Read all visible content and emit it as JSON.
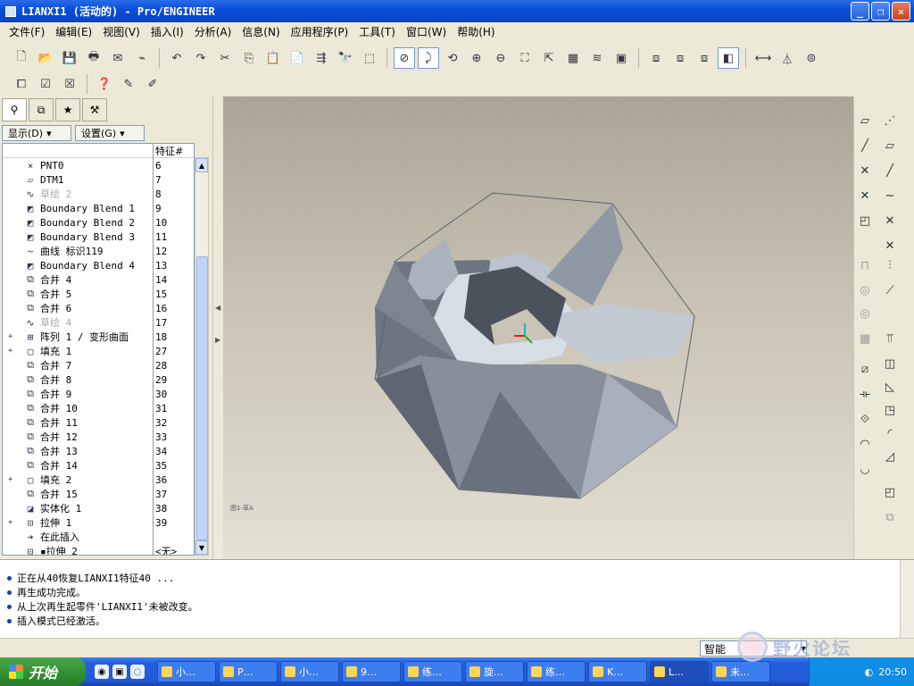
{
  "window": {
    "title": "LIANXI1 (活动的) - Pro/ENGINEER",
    "min": "_",
    "max": "❐",
    "close": "✕"
  },
  "menu": [
    "文件(F)",
    "编辑(E)",
    "视图(V)",
    "插入(I)",
    "分析(A)",
    "信息(N)",
    "应用程序(P)",
    "工具(T)",
    "窗口(W)",
    "帮助(H)"
  ],
  "toolbar1": [
    "new-icon",
    "open-icon",
    "save-icon",
    "print-icon",
    "send-icon",
    "mail-icon",
    "undo-icon",
    "redo-icon",
    "cut-icon",
    "copy-icon",
    "paste-icon",
    "paste-special-icon",
    "regenerate-icon",
    "find-icon",
    "select-box-icon",
    "display-datum-icon",
    "spin-center-icon",
    "orient-icon",
    "zoom-in-icon",
    "zoom-out-icon",
    "refit-icon",
    "reorient-icon",
    "view-manager-icon",
    "layers-icon",
    "model-display-icon",
    "wireframe-icon",
    "hidden-line-icon",
    "no-hidden-icon",
    "shading-icon",
    "datum-planes-icon",
    "datum-axes-icon",
    "datum-points-icon"
  ],
  "toolbar2": [
    "window-icon",
    "activate-icon",
    "close-window-icon",
    "whats-this-icon",
    "feature-edit-icon",
    "sketch-edit-icon"
  ],
  "left_panel": {
    "tabs": [
      "model-tree-tab",
      "layer-tab",
      "favorites-tab",
      "tools-tab"
    ],
    "show_label": "显示(D)",
    "settings_label": "设置(G)",
    "feature_col": "特征#",
    "rows": [
      {
        "label": "PNT0",
        "num": "6",
        "icon": "×",
        "dim": false,
        "exp": ""
      },
      {
        "label": "DTM1",
        "num": "7",
        "icon": "▱",
        "dim": false,
        "exp": ""
      },
      {
        "label": "草绘 2",
        "num": "8",
        "icon": "∿",
        "dim": true,
        "exp": ""
      },
      {
        "label": "Boundary Blend 1",
        "num": "9",
        "icon": "◩",
        "dim": false,
        "exp": ""
      },
      {
        "label": "Boundary Blend 2",
        "num": "10",
        "icon": "◩",
        "dim": false,
        "exp": ""
      },
      {
        "label": "Boundary Blend 3",
        "num": "11",
        "icon": "◩",
        "dim": false,
        "exp": ""
      },
      {
        "label": "曲线 标识119",
        "num": "12",
        "icon": "∼",
        "dim": false,
        "exp": ""
      },
      {
        "label": "Boundary Blend 4",
        "num": "13",
        "icon": "◩",
        "dim": false,
        "exp": ""
      },
      {
        "label": "合并 4",
        "num": "14",
        "icon": "⧉",
        "dim": false,
        "exp": ""
      },
      {
        "label": "合并 5",
        "num": "15",
        "icon": "⧉",
        "dim": false,
        "exp": ""
      },
      {
        "label": "合并 6",
        "num": "16",
        "icon": "⧉",
        "dim": false,
        "exp": ""
      },
      {
        "label": "草绘 4",
        "num": "17",
        "icon": "∿",
        "dim": true,
        "exp": ""
      },
      {
        "label": "阵列 1 / 变形曲面",
        "num": "18",
        "icon": "⊞",
        "dim": false,
        "exp": "+"
      },
      {
        "label": "填充 1",
        "num": "27",
        "icon": "▢",
        "dim": false,
        "exp": "+"
      },
      {
        "label": "合并 7",
        "num": "28",
        "icon": "⧉",
        "dim": false,
        "exp": ""
      },
      {
        "label": "合并 8",
        "num": "29",
        "icon": "⧉",
        "dim": false,
        "exp": ""
      },
      {
        "label": "合并 9",
        "num": "30",
        "icon": "⧉",
        "dim": false,
        "exp": ""
      },
      {
        "label": "合并 10",
        "num": "31",
        "icon": "⧉",
        "dim": false,
        "exp": ""
      },
      {
        "label": "合并 11",
        "num": "32",
        "icon": "⧉",
        "dim": false,
        "exp": ""
      },
      {
        "label": "合并 12",
        "num": "33",
        "icon": "⧉",
        "dim": false,
        "exp": ""
      },
      {
        "label": "合并 13",
        "num": "34",
        "icon": "⧉",
        "dim": false,
        "exp": ""
      },
      {
        "label": "合并 14",
        "num": "35",
        "icon": "⧉",
        "dim": false,
        "exp": ""
      },
      {
        "label": "填充 2",
        "num": "36",
        "icon": "▢",
        "dim": false,
        "exp": "+"
      },
      {
        "label": "合并 15",
        "num": "37",
        "icon": "⧉",
        "dim": false,
        "exp": ""
      },
      {
        "label": "实体化 1",
        "num": "38",
        "icon": "◪",
        "dim": false,
        "exp": ""
      },
      {
        "label": "拉伸 1",
        "num": "39",
        "icon": "⊡",
        "dim": false,
        "exp": "+"
      },
      {
        "label": "在此插入",
        "num": "",
        "icon": "➜",
        "dim": false,
        "exp": ""
      },
      {
        "label": "▪拉伸 2",
        "num": "<无>",
        "icon": "⊡",
        "dim": false,
        "exp": ""
      }
    ]
  },
  "viewport": {
    "label": "图1-草A"
  },
  "messages": [
    "正在从40恢复LIANXI1特征40 ...",
    "再生成功完成。",
    "从上次再生起零件'LIANXI1'未被改变。",
    "插入模式已经激活。"
  ],
  "status": {
    "filter": "智能"
  },
  "taskbar": {
    "start": "开始",
    "tasks": [
      "小…",
      "P…",
      "小…",
      "9…",
      "练…",
      "旋…",
      "练…",
      "K…",
      "L…",
      "未…"
    ],
    "clock": "20:50"
  },
  "watermark": "野火论坛"
}
